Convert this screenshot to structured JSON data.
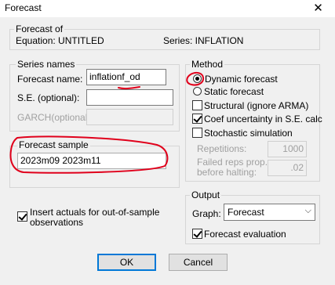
{
  "window": {
    "title": "Forecast",
    "close_symbol": "✕"
  },
  "forecast_of": {
    "legend": "Forecast of",
    "equation": "Equation: UNTITLED",
    "series": "Series: INFLATION"
  },
  "series_names": {
    "legend": "Series names",
    "forecast_name_label": "Forecast name:",
    "forecast_name_value": "inflationf_od",
    "se_label": "S.E. (optional):",
    "se_value": "",
    "garch_label": "GARCH(optional):",
    "garch_value": ""
  },
  "forecast_sample": {
    "legend": "Forecast sample",
    "value": "2023m09 2023m11"
  },
  "insert_actuals": {
    "label": "Insert actuals for out-of-sample observations",
    "checked": true
  },
  "method": {
    "legend": "Method",
    "dynamic_label": "Dynamic forecast",
    "static_label": "Static forecast",
    "selected": "dynamic",
    "structural_label": "Structural (ignore ARMA)",
    "structural_checked": false,
    "coef_label": "Coef uncertainty in S.E. calc",
    "coef_checked": true,
    "stochastic_label": "Stochastic simulation",
    "stochastic_checked": false,
    "repetitions_label": "Repetitions:",
    "repetitions_value": "1000",
    "failed_reps_label_1": "Failed reps prop.",
    "failed_reps_label_2": "before halting:",
    "failed_reps_value": ".02"
  },
  "output": {
    "legend": "Output",
    "graph_label": "Graph:",
    "graph_value": "Forecast",
    "forecast_eval_label": "Forecast evaluation",
    "forecast_eval_checked": true
  },
  "buttons": {
    "ok": "OK",
    "cancel": "Cancel"
  },
  "colors": {
    "annotation": "#e0001b",
    "accent": "#0078d7"
  }
}
